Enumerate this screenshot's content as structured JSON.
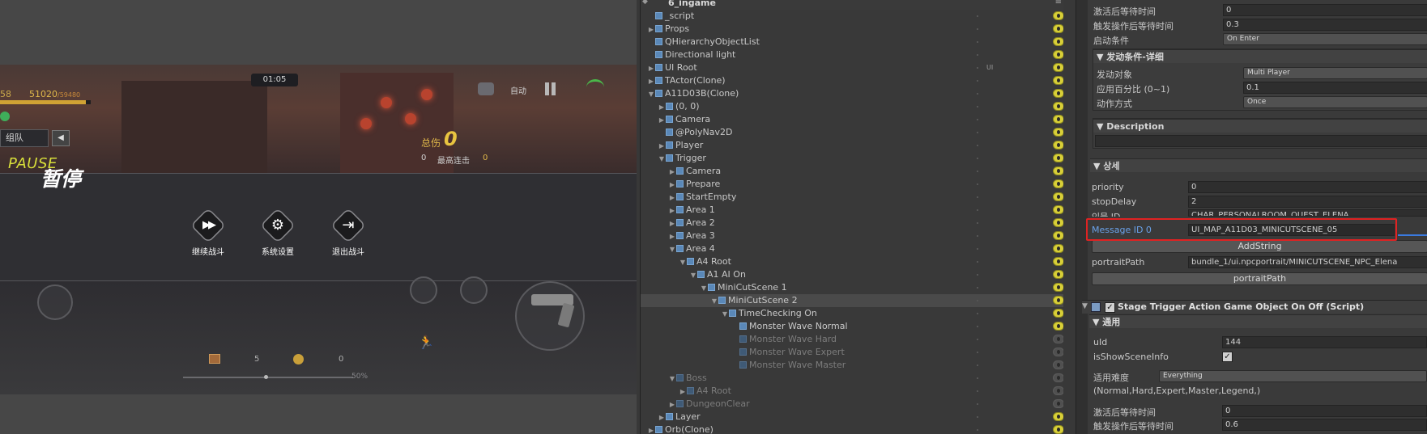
{
  "game": {
    "timer": "01:05",
    "hp_left": "58",
    "hp": "51020",
    "hp_max": "/59480",
    "party_label": "组队",
    "party_arrow": "◀",
    "auto_label": "自动",
    "damage_label": "总伤",
    "damage_value": "0",
    "combo_small": "0",
    "combo_label": "最高连击",
    "combo_value": "0",
    "pause_en": "PAUSE",
    "pause_zh": "暂停",
    "menu": [
      {
        "label": "继续战斗",
        "icon": "fast-forward-icon",
        "glyph": "▶▶"
      },
      {
        "label": "系统设置",
        "icon": "gear-icon",
        "glyph": "⚙"
      },
      {
        "label": "退出战斗",
        "icon": "exit-icon",
        "glyph": "⇥"
      }
    ],
    "chest_count": "5",
    "coin_count": "0",
    "progress_pct": "50%"
  },
  "hierarchy": {
    "scene_name": "6_ingame",
    "menu_glyph": "≡",
    "rows": [
      {
        "label": "_script",
        "depth": 0,
        "toggle": "",
        "dim": false,
        "tag": ""
      },
      {
        "label": "Props",
        "depth": 0,
        "toggle": "▶",
        "dim": false,
        "tag": ""
      },
      {
        "label": "QHierarchyObjectList",
        "depth": 0,
        "toggle": "",
        "dim": false,
        "tag": ""
      },
      {
        "label": "Directional light",
        "depth": 0,
        "toggle": "",
        "dim": false,
        "tag": ""
      },
      {
        "label": "UI Root",
        "depth": 0,
        "toggle": "▶",
        "dim": false,
        "tag": "UI"
      },
      {
        "label": "TActor(Clone)",
        "depth": 0,
        "toggle": "▶",
        "dim": false,
        "tag": ""
      },
      {
        "label": "A11D03B(Clone)",
        "depth": 0,
        "toggle": "▼",
        "dim": false,
        "tag": ""
      },
      {
        "label": "(0, 0)",
        "depth": 1,
        "toggle": "▶",
        "dim": false,
        "tag": ""
      },
      {
        "label": "Camera",
        "depth": 1,
        "toggle": "▶",
        "dim": false,
        "tag": ""
      },
      {
        "label": "@PolyNav2D",
        "depth": 1,
        "toggle": "",
        "dim": false,
        "tag": ""
      },
      {
        "label": "Player",
        "depth": 1,
        "toggle": "▶",
        "dim": false,
        "tag": ""
      },
      {
        "label": "Trigger",
        "depth": 1,
        "toggle": "▼",
        "dim": false,
        "tag": ""
      },
      {
        "label": "Camera",
        "depth": 2,
        "toggle": "▶",
        "dim": false,
        "tag": ""
      },
      {
        "label": "Prepare",
        "depth": 2,
        "toggle": "▶",
        "dim": false,
        "tag": ""
      },
      {
        "label": "StartEmpty",
        "depth": 2,
        "toggle": "▶",
        "dim": false,
        "tag": ""
      },
      {
        "label": "Area 1",
        "depth": 2,
        "toggle": "▶",
        "dim": false,
        "tag": ""
      },
      {
        "label": "Area 2",
        "depth": 2,
        "toggle": "▶",
        "dim": false,
        "tag": ""
      },
      {
        "label": "Area 3",
        "depth": 2,
        "toggle": "▶",
        "dim": false,
        "tag": ""
      },
      {
        "label": "Area 4",
        "depth": 2,
        "toggle": "▼",
        "dim": false,
        "tag": ""
      },
      {
        "label": "A4 Root",
        "depth": 3,
        "toggle": "▼",
        "dim": false,
        "tag": ""
      },
      {
        "label": "A1 AI On",
        "depth": 4,
        "toggle": "▼",
        "dim": false,
        "tag": ""
      },
      {
        "label": "MiniCutScene 1",
        "depth": 5,
        "toggle": "▼",
        "dim": false,
        "tag": ""
      },
      {
        "label": "MiniCutScene 2",
        "depth": 6,
        "toggle": "▼",
        "dim": false,
        "tag": "",
        "selected": true
      },
      {
        "label": "TimeChecking On",
        "depth": 7,
        "toggle": "▼",
        "dim": false,
        "tag": ""
      },
      {
        "label": "Monster Wave Normal",
        "depth": 8,
        "toggle": "",
        "dim": false,
        "tag": ""
      },
      {
        "label": "Monster Wave Hard",
        "depth": 8,
        "toggle": "",
        "dim": true,
        "tag": ""
      },
      {
        "label": "Monster Wave Expert",
        "depth": 8,
        "toggle": "",
        "dim": true,
        "tag": ""
      },
      {
        "label": "Monster Wave Master",
        "depth": 8,
        "toggle": "",
        "dim": true,
        "tag": ""
      },
      {
        "label": "Boss",
        "depth": 2,
        "toggle": "▼",
        "dim": true,
        "tag": ""
      },
      {
        "label": "A4 Root",
        "depth": 3,
        "toggle": "▶",
        "dim": true,
        "tag": ""
      },
      {
        "label": "DungeonClear",
        "depth": 2,
        "toggle": "▶",
        "dim": true,
        "tag": ""
      },
      {
        "label": "Layer",
        "depth": 1,
        "toggle": "▶",
        "dim": false,
        "tag": ""
      },
      {
        "label": "Orb(Clone)",
        "depth": 0,
        "toggle": "▶",
        "dim": false,
        "tag": ""
      }
    ]
  },
  "inspector": {
    "top": {
      "wait_after_activate_label": "激活后等待时间",
      "wait_after_activate_value": "0",
      "wait_after_trigger_label": "触发操作后等待时间",
      "wait_after_trigger_value": "0.3",
      "start_condition_label": "启动条件",
      "start_condition_value": "On Enter"
    },
    "trigger_detail": {
      "header": "▼ 发动条件-详细",
      "target_label": "发动对象",
      "target_value": "Multi Player",
      "percent_label": "应用百分比 (0~1)",
      "percent_value": "0.1",
      "mode_label": "动作方式",
      "mode_value": "Once"
    },
    "description": {
      "header": "▼ Description"
    },
    "detail": {
      "header": "▼ 상세",
      "priority_label": "priority",
      "priority_value": "0",
      "stop_delay_label": "stopDelay",
      "stop_delay_value": "2",
      "partial_label": "인물 ID",
      "partial_value": "CHAR_PERSONALROOM_QUEST_ELENA",
      "message_label": "Message ID 0",
      "message_value": "UI_MAP_A11D03_MINICUTSCENE_05",
      "add_string_label": "AddString",
      "portrait_label": "portraitPath",
      "portrait_value": "bundle_1/ui.npcportrait/MINICUTSCENE_NPC_Elena",
      "portrait_button": "portraitPath"
    },
    "script": {
      "check": "✓",
      "title": "Stage Trigger Action Game Object On Off (Script)",
      "general_header": "▼ 通用",
      "uid_label": "uId",
      "uid_value": "144",
      "show_scene_label": "isShowSceneInfo",
      "show_scene_check": "✓",
      "difficulty_label": "适用难度",
      "difficulty_value": "Everything",
      "difficulty_list": "(Normal,Hard,Expert,Master,Legend,)",
      "wait_after_activate_label": "激活后等待时间",
      "wait_after_activate_value": "0",
      "wait_after_trigger_label": "触发操作后等待时间",
      "wait_after_trigger_value": "0.6"
    }
  }
}
